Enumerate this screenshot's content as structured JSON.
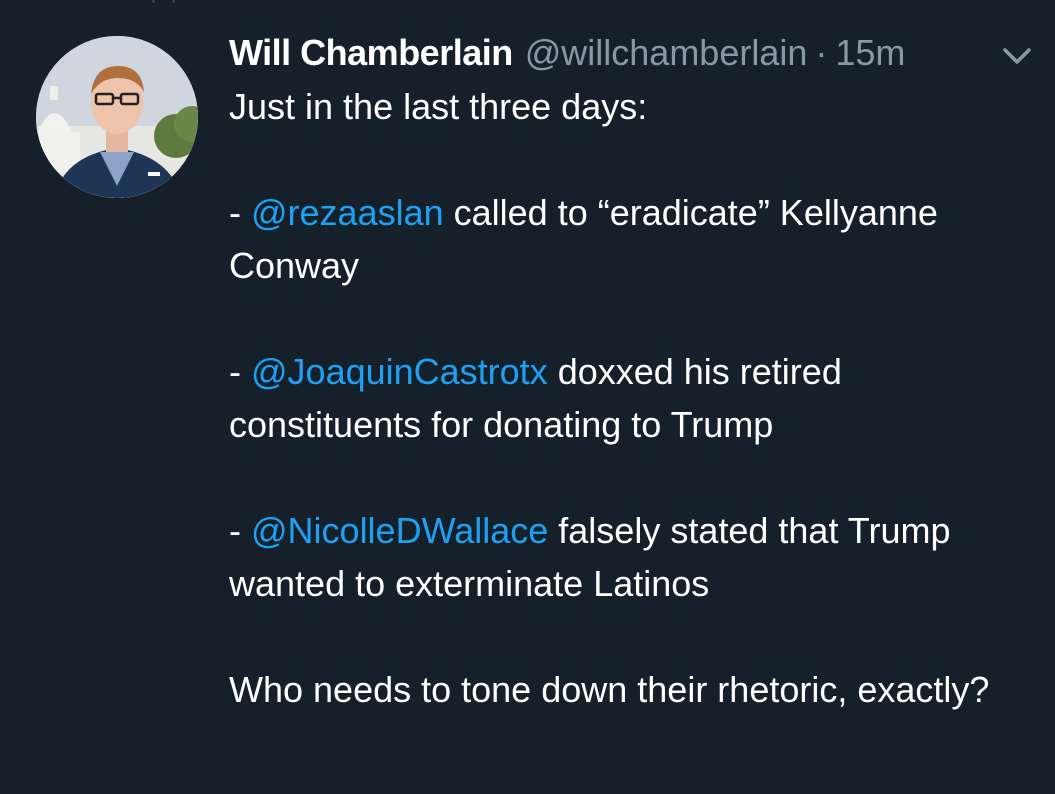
{
  "top_fragment": "· ·",
  "tweet": {
    "display_name": "Will Chamberlain",
    "handle": "@willchamberlain",
    "separator": "·",
    "time": "15m",
    "intro": "Just in the last three days:",
    "items": [
      {
        "dash": "- ",
        "mention": "@rezaaslan",
        "text": " called to “eradicate” Kellyanne Conway"
      },
      {
        "dash": "- ",
        "mention": "@JoaquinCastrotx",
        "text": " doxxed his retired constituents for donating to Trump"
      },
      {
        "dash": "- ",
        "mention": "@NicolleDWallace",
        "text": " falsely stated that Trump wanted to exterminate Latinos"
      }
    ],
    "closing": "Who needs to tone down their rhetoric, exactly?"
  },
  "icons": {
    "menu": "chevron-down-icon",
    "avatar": "profile-photo"
  },
  "colors": {
    "background": "#15202b",
    "text": "#ffffff",
    "secondary": "#8899a6",
    "link": "#1da1f2"
  }
}
